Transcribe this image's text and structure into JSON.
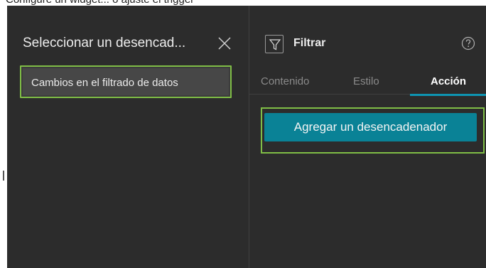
{
  "header_fragment": "Configure un widget... o ajuste el trigger",
  "left_panel": {
    "title": "Seleccionar un desencad...",
    "items": [
      {
        "label": "Cambios en el filtrado de datos"
      }
    ]
  },
  "right_panel": {
    "title": "Filtrar",
    "tabs": [
      {
        "label": "Contenido",
        "active": false
      },
      {
        "label": "Estilo",
        "active": false
      },
      {
        "label": "Acción",
        "active": true
      }
    ],
    "add_trigger_label": "Agregar un desencadenador"
  },
  "colors": {
    "panel_bg": "#2c2c2c",
    "highlight_border": "#7fbd46",
    "accent": "#0a8296",
    "tab_underline": "#0e94b1"
  },
  "icons": [
    "close-icon",
    "filter-icon",
    "help-icon"
  ]
}
